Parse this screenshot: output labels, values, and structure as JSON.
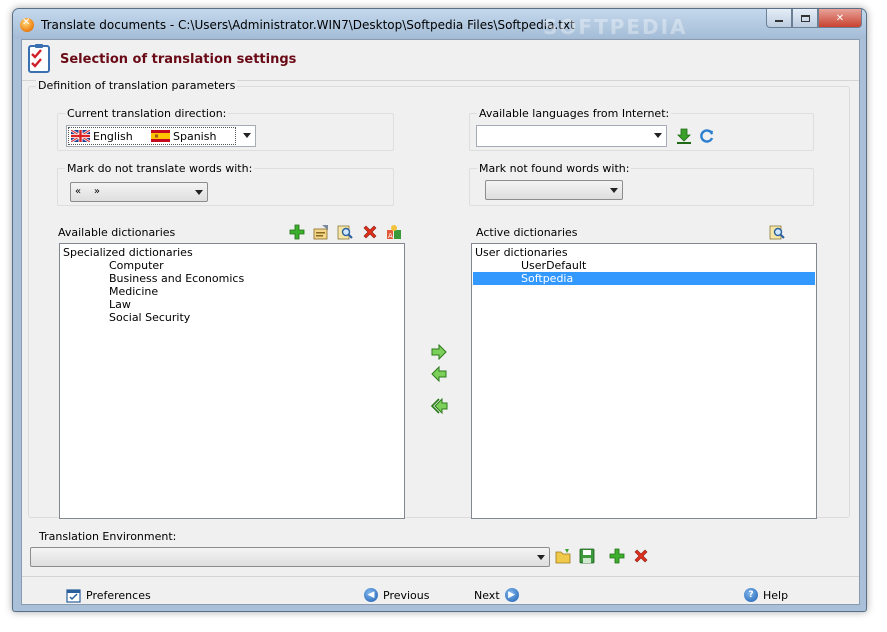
{
  "window": {
    "title": "Translate documents - C:\\Users\\Administrator.WIN7\\Desktop\\Softpedia Files\\Softpedia.txt",
    "watermark": "SOFTPEDIA"
  },
  "header": {
    "title": "Selection of translation settings"
  },
  "params": {
    "legend": "Definition of translation parameters",
    "direction": {
      "label": "Current translation direction:",
      "source": "English",
      "target": "Spanish"
    },
    "internet": {
      "label": "Available languages from Internet:",
      "value": ""
    },
    "dnt": {
      "label": "Mark do not translate words with:",
      "value": "«    »"
    },
    "notfound": {
      "label": "Mark not found words with:",
      "value": ""
    }
  },
  "available": {
    "label": "Available dictionaries",
    "items": [
      {
        "text": "Specialized dictionaries",
        "level": 0
      },
      {
        "text": "Computer",
        "level": 1
      },
      {
        "text": "Business and Economics",
        "level": 1
      },
      {
        "text": "Medicine",
        "level": 1
      },
      {
        "text": "Law",
        "level": 1
      },
      {
        "text": "Social Security",
        "level": 1
      }
    ]
  },
  "active": {
    "label": "Active dictionaries",
    "items": [
      {
        "text": "User dictionaries",
        "level": 0
      },
      {
        "text": "UserDefault",
        "level": 1
      },
      {
        "text": "Softpedia",
        "level": 1,
        "selected": true
      }
    ]
  },
  "environment": {
    "label": "Translation Environment:",
    "value": ""
  },
  "footer": {
    "preferences": "Preferences",
    "previous": "Previous",
    "next": "Next",
    "help": "Help"
  },
  "colors": {
    "header_title": "#6a0a16",
    "selection": "#3399ff"
  }
}
